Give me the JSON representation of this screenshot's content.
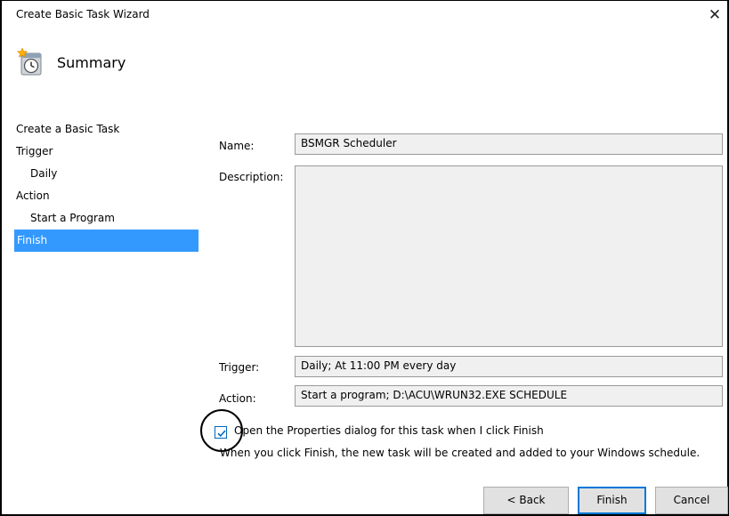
{
  "window": {
    "title": "Create Basic Task Wizard",
    "close_glyph": "✕"
  },
  "header": {
    "title": "Summary",
    "icon": "task-scheduler-clock-icon"
  },
  "steps": [
    {
      "label": "Create a Basic Task",
      "indent": false,
      "active": false
    },
    {
      "label": "Trigger",
      "indent": false,
      "active": false
    },
    {
      "label": "Daily",
      "indent": true,
      "active": false
    },
    {
      "label": "Action",
      "indent": false,
      "active": false
    },
    {
      "label": "Start a Program",
      "indent": true,
      "active": false
    },
    {
      "label": "Finish",
      "indent": false,
      "active": true
    }
  ],
  "summary": {
    "name_label": "Name:",
    "name_value": "BSMGR Scheduler",
    "description_label": "Description:",
    "description_value": "",
    "trigger_label": "Trigger:",
    "trigger_value": "Daily; At 11:00 PM every day",
    "action_label": "Action:",
    "action_value": "Start a program; D:\\ACU\\WRUN32.EXE SCHEDULE"
  },
  "open_properties": {
    "checked": true,
    "label": "Open the Properties dialog for this task when I click Finish"
  },
  "info_text": "When you click Finish, the new task will be created and added to your Windows schedule.",
  "buttons": {
    "back": "< Back",
    "finish": "Finish",
    "cancel": "Cancel"
  },
  "colors": {
    "selection": "#3399ff",
    "field_bg": "#f0f0f0",
    "accent": "#0078d7"
  }
}
